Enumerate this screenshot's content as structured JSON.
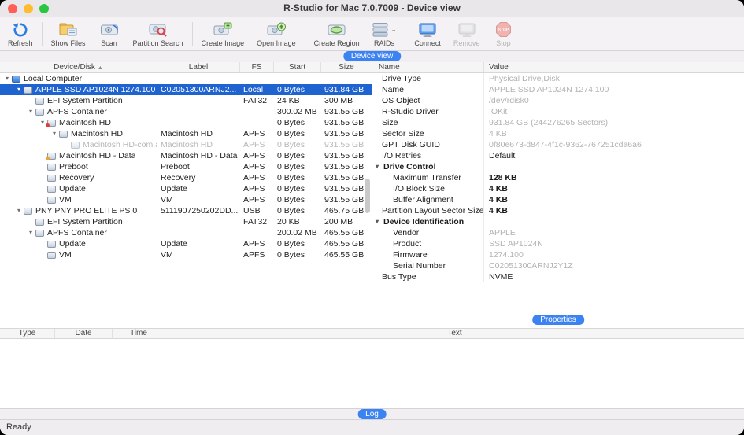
{
  "window": {
    "title": "R-Studio for Mac 7.0.7009 - Device view"
  },
  "toolbar": {
    "buttons": [
      {
        "label": "Refresh",
        "icon": "refresh-icon",
        "enabled": true
      },
      {
        "label": "Show Files",
        "icon": "show-files-icon",
        "enabled": true
      },
      {
        "label": "Scan",
        "icon": "scan-icon",
        "enabled": true
      },
      {
        "label": "Partition Search",
        "icon": "partition-search-icon",
        "enabled": true
      },
      {
        "label": "Create Image",
        "icon": "create-image-icon",
        "enabled": true
      },
      {
        "label": "Open Image",
        "icon": "open-image-icon",
        "enabled": true
      },
      {
        "label": "Create Region",
        "icon": "create-region-icon",
        "enabled": true
      },
      {
        "label": "RAIDs",
        "icon": "raids-icon",
        "enabled": true,
        "has_dropdown": true
      },
      {
        "label": "Connect",
        "icon": "connect-icon",
        "enabled": true
      },
      {
        "label": "Remove",
        "icon": "remove-icon",
        "enabled": false
      },
      {
        "label": "Stop",
        "icon": "stop-icon",
        "enabled": false
      }
    ]
  },
  "tabs": {
    "device_view": "Device view",
    "properties": "Properties",
    "log": "Log"
  },
  "device_table": {
    "columns": [
      "Device/Disk",
      "Label",
      "FS",
      "Start",
      "Size"
    ],
    "rows": [
      {
        "name": "Local Computer",
        "label": "",
        "fs": "",
        "start": "",
        "size": ""
      },
      {
        "name": "APPLE SSD AP1024N 1274.100",
        "label": "C02051300ARNJ2...",
        "fs": "Local",
        "start": "0 Bytes",
        "size": "931.84 GB"
      },
      {
        "name": "EFI System Partition",
        "label": "",
        "fs": "FAT32",
        "start": "24 KB",
        "size": "300 MB"
      },
      {
        "name": "APFS Container",
        "label": "",
        "fs": "",
        "start": "300.02 MB",
        "size": "931.55 GB"
      },
      {
        "name": "Macintosh HD",
        "label": "",
        "fs": "",
        "start": "0 Bytes",
        "size": "931.55 GB"
      },
      {
        "name": "Macintosh HD",
        "label": "Macintosh HD",
        "fs": "APFS",
        "start": "0 Bytes",
        "size": "931.55 GB"
      },
      {
        "name": "Macintosh HD-com.apple...",
        "label": "Macintosh HD",
        "fs": "APFS",
        "start": "0 Bytes",
        "size": "931.55 GB"
      },
      {
        "name": "Macintosh HD - Data",
        "label": "Macintosh HD - Data",
        "fs": "APFS",
        "start": "0 Bytes",
        "size": "931.55 GB"
      },
      {
        "name": "Preboot",
        "label": "Preboot",
        "fs": "APFS",
        "start": "0 Bytes",
        "size": "931.55 GB"
      },
      {
        "name": "Recovery",
        "label": "Recovery",
        "fs": "APFS",
        "start": "0 Bytes",
        "size": "931.55 GB"
      },
      {
        "name": "Update",
        "label": "Update",
        "fs": "APFS",
        "start": "0 Bytes",
        "size": "931.55 GB"
      },
      {
        "name": "VM",
        "label": "VM",
        "fs": "APFS",
        "start": "0 Bytes",
        "size": "931.55 GB"
      },
      {
        "name": "PNY PNY PRO ELITE PS 0",
        "label": "5111907250202DD...",
        "fs": "USB",
        "start": "0 Bytes",
        "size": "465.75 GB"
      },
      {
        "name": "EFI System Partition",
        "label": "",
        "fs": "FAT32",
        "start": "20 KB",
        "size": "200 MB"
      },
      {
        "name": "APFS Container",
        "label": "",
        "fs": "",
        "start": "200.02 MB",
        "size": "465.55 GB"
      },
      {
        "name": "Update",
        "label": "Update",
        "fs": "APFS",
        "start": "0 Bytes",
        "size": "465.55 GB"
      },
      {
        "name": "VM",
        "label": "VM",
        "fs": "APFS",
        "start": "0 Bytes",
        "size": "465.55 GB"
      }
    ]
  },
  "properties_panel": {
    "columns": [
      "Name",
      "Value"
    ],
    "rows": [
      {
        "name": "Drive Type",
        "value": "Physical Drive,Disk"
      },
      {
        "name": "Name",
        "value": "APPLE SSD AP1024N 1274.100"
      },
      {
        "name": "OS Object",
        "value": "/dev/rdisk0"
      },
      {
        "name": "R-Studio Driver",
        "value": "IOKit"
      },
      {
        "name": "Size",
        "value": "931.84 GB (244276265 Sectors)"
      },
      {
        "name": "Sector Size",
        "value": "4 KB"
      },
      {
        "name": "GPT Disk GUID",
        "value": "0f80e673-d847-4f1c-9362-767251cda6a6"
      },
      {
        "name": "I/O Retries",
        "value": "Default"
      },
      {
        "name": "Drive Control",
        "value": ""
      },
      {
        "name": "Maximum Transfer",
        "value": "128 KB"
      },
      {
        "name": "I/O Block Size",
        "value": "4 KB"
      },
      {
        "name": "Buffer Alignment",
        "value": "4 KB"
      },
      {
        "name": "Partition Layout Sector Size",
        "value": "4 KB"
      },
      {
        "name": "Device Identification",
        "value": ""
      },
      {
        "name": "Vendor",
        "value": "APPLE"
      },
      {
        "name": "Product",
        "value": "SSD AP1024N"
      },
      {
        "name": "Firmware",
        "value": "1274.100"
      },
      {
        "name": "Serial Number",
        "value": "C02051300ARNJ2Y1Z"
      },
      {
        "name": "Bus Type",
        "value": "NVME"
      }
    ]
  },
  "log_panel": {
    "columns": [
      "Type",
      "Date",
      "Time",
      "Text"
    ]
  },
  "status_bar": {
    "text": "Ready"
  },
  "colors": {
    "selection": "#1e63d0",
    "accent_pill": "#3b82f2",
    "badge_red": "#e33b3b",
    "badge_yellow": "#f0a32e"
  }
}
